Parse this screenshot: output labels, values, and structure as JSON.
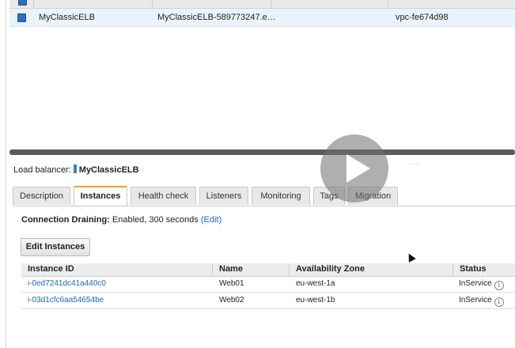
{
  "top_table": {
    "row": {
      "name": "MyClassicELB",
      "dns": "MyClassicELB-589773247.e…",
      "vpc": "vpc-fe674d98"
    }
  },
  "load_balancer": {
    "label": "Load balancer:",
    "name": "MyClassicELB"
  },
  "tabs": [
    {
      "label": "Description"
    },
    {
      "label": "Instances"
    },
    {
      "label": "Health check"
    },
    {
      "label": "Listeners"
    },
    {
      "label": "Monitoring"
    },
    {
      "label": "Tags"
    },
    {
      "label": "Migration"
    }
  ],
  "connection_draining": {
    "label": "Connection Draining:",
    "value": "Enabled, 300 seconds",
    "edit_link": "(Edit)"
  },
  "edit_instances_button": "Edit Instances",
  "instances_table": {
    "headers": [
      "Instance ID",
      "Name",
      "Availability Zone",
      "Status"
    ],
    "rows": [
      {
        "id": "i-0ed7241dc41a440c0",
        "name": "Web01",
        "az": "eu-west-1a",
        "status": "InService"
      },
      {
        "id": "i-03d1cfc6aa54654be",
        "name": "Web02",
        "az": "eu-west-1b",
        "status": "InService"
      }
    ]
  },
  "info_icon_glyph": "i",
  "colors": {
    "link": "#1b66b8",
    "selected_row": "#eaf3fb",
    "active_tab_accent": "#f0a020",
    "checkbox": "#2f6dbf"
  }
}
